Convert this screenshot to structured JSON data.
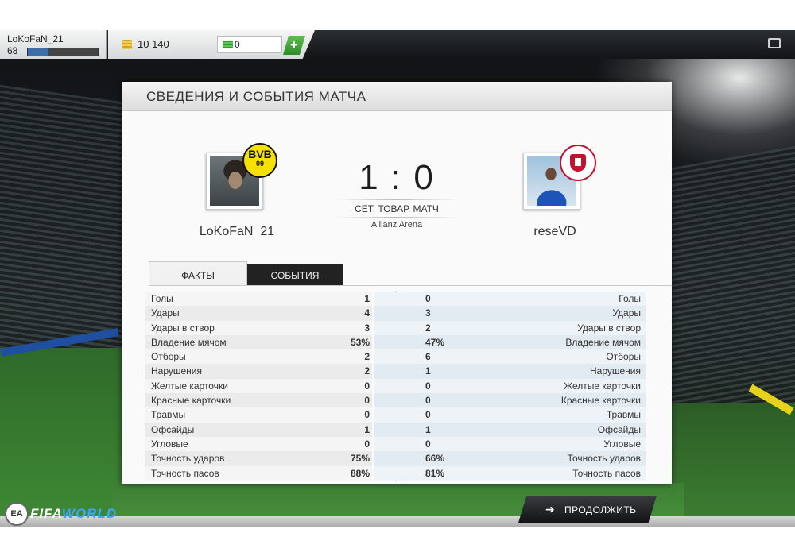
{
  "topbar": {
    "player_name": "LoKoFaN_21",
    "player_level": "68",
    "xp_progress": 0.3,
    "coins": "10 140",
    "points": "0",
    "add_points_label": "+"
  },
  "panel": {
    "title": "СВЕДЕНИЯ И СОБЫТИЯ МАТЧА"
  },
  "match": {
    "home_club_badge": "BVB 09",
    "home_player": "LoKoFaN_21",
    "away_player": "reseVD",
    "score": "1 : 0",
    "match_type": "СЕТ. ТОВАР. МАТЧ",
    "stadium": "Allianz Arena"
  },
  "tabs": {
    "facts": "ФАКТЫ",
    "events": "СОБЫТИЯ"
  },
  "stats": [
    {
      "label": "Голы",
      "home": "1",
      "away": "0"
    },
    {
      "label": "Удары",
      "home": "4",
      "away": "3"
    },
    {
      "label": "Удары в створ",
      "home": "3",
      "away": "2"
    },
    {
      "label": "Владение мячом",
      "home": "53%",
      "away": "47%"
    },
    {
      "label": "Отборы",
      "home": "2",
      "away": "6"
    },
    {
      "label": "Нарушения",
      "home": "2",
      "away": "1"
    },
    {
      "label": "Желтые карточки",
      "home": "0",
      "away": "0"
    },
    {
      "label": "Красные карточки",
      "home": "0",
      "away": "0"
    },
    {
      "label": "Травмы",
      "home": "0",
      "away": "0"
    },
    {
      "label": "Офсайды",
      "home": "1",
      "away": "1"
    },
    {
      "label": "Угловые",
      "home": "0",
      "away": "0"
    },
    {
      "label": "Точность ударов",
      "home": "75%",
      "away": "66%"
    },
    {
      "label": "Точность пасов",
      "home": "88%",
      "away": "81%"
    }
  ],
  "footer": {
    "ea_logo": "EA",
    "brand_part1": "FIFA",
    "brand_part2": "WORLD",
    "continue_label": "ПРОДОЛЖИТЬ",
    "continue_icon": "arrow-right-icon"
  },
  "colors": {
    "accent_green": "#2f8a2a",
    "xp_blue": "#3e6ea8",
    "dark_button": "#111314"
  }
}
